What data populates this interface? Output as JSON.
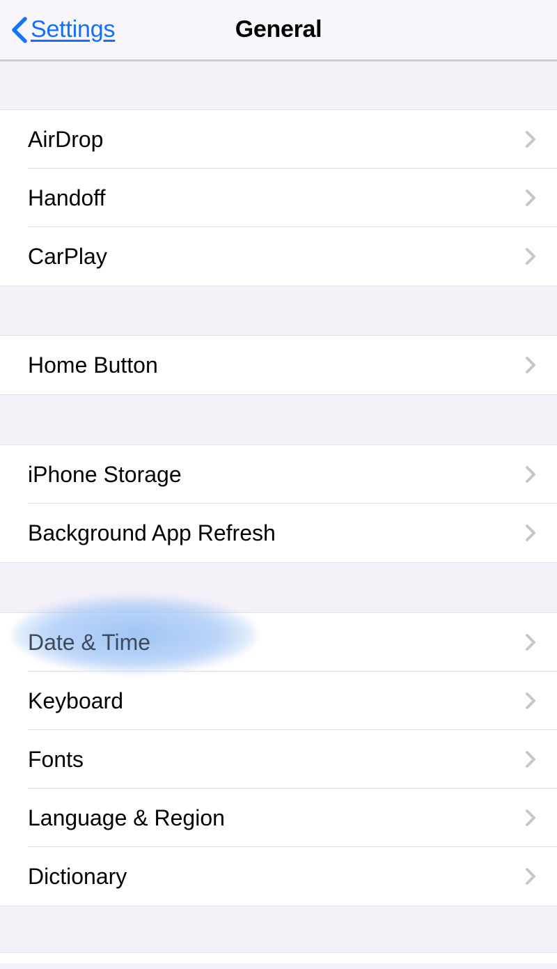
{
  "nav": {
    "back_label": "Settings",
    "title": "General"
  },
  "groups": [
    {
      "items": [
        {
          "id": "airdrop",
          "label": "AirDrop",
          "highlighted": false
        },
        {
          "id": "handoff",
          "label": "Handoff",
          "highlighted": false
        },
        {
          "id": "carplay",
          "label": "CarPlay",
          "highlighted": false
        }
      ]
    },
    {
      "items": [
        {
          "id": "home-button",
          "label": "Home Button",
          "highlighted": false
        }
      ]
    },
    {
      "items": [
        {
          "id": "iphone-storage",
          "label": "iPhone Storage",
          "highlighted": false
        },
        {
          "id": "background-app-refresh",
          "label": "Background App Refresh",
          "highlighted": false
        }
      ]
    },
    {
      "items": [
        {
          "id": "date-time",
          "label": "Date & Time",
          "highlighted": true
        },
        {
          "id": "keyboard",
          "label": "Keyboard",
          "highlighted": false
        },
        {
          "id": "fonts",
          "label": "Fonts",
          "highlighted": false
        },
        {
          "id": "language-region",
          "label": "Language & Region",
          "highlighted": false
        },
        {
          "id": "dictionary",
          "label": "Dictionary",
          "highlighted": false
        }
      ]
    }
  ]
}
